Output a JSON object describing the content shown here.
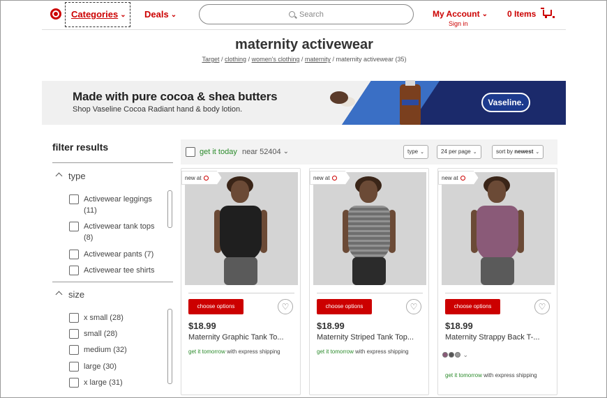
{
  "header": {
    "categories_label": "Categories",
    "deals_label": "Deals",
    "search_placeholder": "Search",
    "account_label": "My Account",
    "signin_label": "Sign in",
    "cart_label": "0 Items",
    "icons": [
      "target-logo-icon",
      "search-icon",
      "cart-icon"
    ]
  },
  "page": {
    "title": "maternity activewear",
    "breadcrumb": [
      {
        "label": "Target",
        "link": true
      },
      {
        "label": "clothing",
        "link": true
      },
      {
        "label": "women's clothing",
        "link": true
      },
      {
        "label": "maternity",
        "link": true
      },
      {
        "label": "maternity activewear (35)",
        "link": false
      }
    ],
    "breadcrumb_sep": "/"
  },
  "banner": {
    "headline": "Made with pure cocoa & shea butters",
    "subline": "Shop Vaseline Cocoa Radiant hand & body lotion.",
    "brand": "Vaseline."
  },
  "sidebar": {
    "title": "filter results",
    "groups": [
      {
        "name": "type",
        "items": [
          {
            "label": "Activewear leggings",
            "count": "(11)"
          },
          {
            "label": "Activewear tank tops",
            "count": "(8)"
          },
          {
            "label": "Activewear pants",
            "count": "(7)"
          },
          {
            "label": "Activewear tee shirts",
            "count": ""
          }
        ]
      },
      {
        "name": "size",
        "items": [
          {
            "label": "x small",
            "count": "(28)"
          },
          {
            "label": "small",
            "count": "(28)"
          },
          {
            "label": "medium",
            "count": "(32)"
          },
          {
            "label": "large",
            "count": "(30)"
          },
          {
            "label": "x large",
            "count": "(31)"
          }
        ]
      }
    ]
  },
  "toolbar": {
    "get_it_today": "get it today",
    "near": "near 52404",
    "type_label": "type",
    "per_page_label": "24 per page",
    "sort_prefix": "sort by",
    "sort_value": "newest"
  },
  "products": [
    {
      "tag": "new at",
      "button": "choose options",
      "price": "$18.99",
      "name": "Maternity Graphic Tank To...",
      "ship_highlight": "get it tomorrow",
      "ship_rest": "with express shipping",
      "has_swatches": false,
      "colors": {
        "top": "#1f1f1f",
        "legs": "#5a5a5a"
      }
    },
    {
      "tag": "new at",
      "button": "choose options",
      "price": "$18.99",
      "name": "Maternity Striped Tank Top...",
      "ship_highlight": "get it tomorrow",
      "ship_rest": "with express shipping",
      "has_swatches": false,
      "colors": {
        "top": "#6e6e6e",
        "legs": "#2b2b2b"
      }
    },
    {
      "tag": "new at",
      "button": "choose options",
      "price": "$18.99",
      "name": "Maternity Strappy Back T-...",
      "ship_highlight": "get it tomorrow",
      "ship_rest": "with express shipping",
      "has_swatches": true,
      "colors": {
        "top": "#8a5a78",
        "legs": "#5a5a5a"
      }
    }
  ],
  "colors": {
    "brand_red": "#cc0000",
    "green": "#2a8a2a",
    "banner_navy": "#1b2a6b"
  }
}
